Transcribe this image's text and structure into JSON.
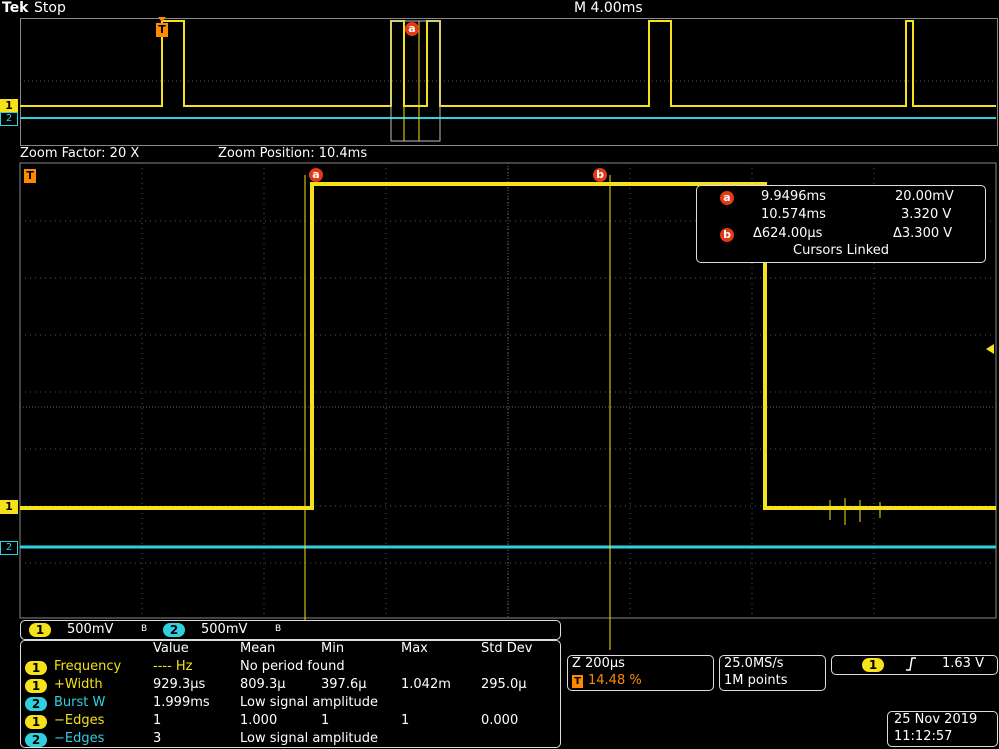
{
  "header": {
    "brand": "Tek",
    "run_state": "Stop",
    "timebase": "M 4.00ms"
  },
  "overview": {
    "ch1_marker": "1",
    "ch2_marker": "2",
    "trigger_marker": "T",
    "cursor_a": "a"
  },
  "zoom": {
    "factor": "Zoom Factor: 20 X",
    "position": "Zoom Position: 10.4ms"
  },
  "main": {
    "trigger_marker": "T",
    "cursor_a": "a",
    "cursor_b": "b",
    "ch1_marker": "1",
    "ch2_marker": "2"
  },
  "cursor_readout": {
    "a_label": "a",
    "b_label": "b",
    "a_time": "9.9496ms",
    "a_volt": "20.00mV",
    "b_time": "10.574ms",
    "b_volt": "3.320 V",
    "delta_time": "Δ624.00µs",
    "delta_volt": "Δ3.300 V",
    "mode": "Cursors Linked"
  },
  "channel_bar": {
    "ch1": "1",
    "ch1_scale": "500mV",
    "ch1_bw": "B",
    "ch2": "2",
    "ch2_scale": "500mV",
    "ch2_bw": "B"
  },
  "measurements": {
    "headers": [
      "Value",
      "Mean",
      "Min",
      "Max",
      "Std Dev"
    ],
    "rows": [
      {
        "ch": "1",
        "name": "Frequency",
        "value": "---- Hz",
        "mean": "No period found",
        "min": "",
        "max": "",
        "std": ""
      },
      {
        "ch": "1",
        "name": "+Width",
        "value": "929.3µs",
        "mean": "809.3µ",
        "min": "397.6µ",
        "max": "1.042m",
        "std": "295.0µ"
      },
      {
        "ch": "2",
        "name": "Burst W",
        "value": "1.999ms",
        "mean": "Low signal amplitude",
        "min": "",
        "max": "",
        "std": ""
      },
      {
        "ch": "1",
        "name": "−Edges",
        "value": "1",
        "mean": "1.000",
        "min": "1",
        "max": "1",
        "std": "0.000"
      },
      {
        "ch": "2",
        "name": "−Edges",
        "value": "3",
        "mean": "Low signal amplitude",
        "min": "",
        "max": "",
        "std": ""
      }
    ]
  },
  "zoom_info": {
    "scale": "Z 200µs",
    "trigger_marker": "T",
    "position_pct": "14.48 %"
  },
  "acquisition": {
    "rate": "25.0MS/s",
    "points": "1M points"
  },
  "trigger": {
    "ch": "1",
    "slope_icon": "rising-edge-icon",
    "level": "1.63 V"
  },
  "datetime": {
    "date": "25 Nov 2019",
    "time": "11:12:57"
  },
  "colors": {
    "ch1": "#f5e21a",
    "ch2": "#2fd1e0",
    "cursor_dot": "#e23a15",
    "trigger": "#ff8a00"
  }
}
